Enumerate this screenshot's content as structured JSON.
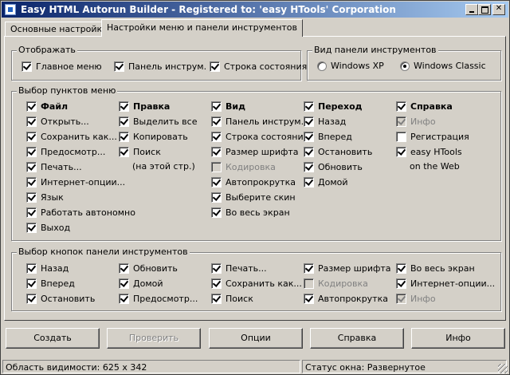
{
  "window": {
    "title": "Easy HTML Autorun Builder - Registered to: 'easy HTools' Corporation"
  },
  "tabs": [
    "Основные настройки",
    "Настройки меню и панели инструментов"
  ],
  "display_group": {
    "title": "Отображать",
    "items": [
      {
        "label": "Главное меню",
        "checked": true
      },
      {
        "label": "Панель инструм.",
        "checked": true
      },
      {
        "label": "Строка состояния",
        "checked": true
      }
    ]
  },
  "toolbar_view_group": {
    "title": "Вид панели инструментов",
    "options": [
      {
        "label": "Windows XP",
        "selected": false
      },
      {
        "label": "Windows Classic",
        "selected": true
      }
    ]
  },
  "menu_group": {
    "title": "Выбор пунктов меню",
    "columns": [
      {
        "items": [
          {
            "label": "Файл",
            "checked": true,
            "bold": true
          },
          {
            "label": "Открыть...",
            "checked": true
          },
          {
            "label": "Сохранить как...",
            "checked": true
          },
          {
            "label": "Предосмотр...",
            "checked": true
          },
          {
            "label": "Печать...",
            "checked": true
          },
          {
            "label": "Интернет-опции...",
            "checked": true
          },
          {
            "label": "Язык",
            "checked": true
          },
          {
            "label": "Работать автономно",
            "checked": true
          },
          {
            "label": "Выход",
            "checked": true
          }
        ]
      },
      {
        "items": [
          {
            "label": "Правка",
            "checked": true,
            "bold": true
          },
          {
            "label": "Выделить все",
            "checked": true
          },
          {
            "label": "Копировать",
            "checked": true
          },
          {
            "label": "Поиск",
            "checked": true
          }
        ],
        "note": "(на этой стр.)"
      },
      {
        "items": [
          {
            "label": "Вид",
            "checked": true,
            "bold": true
          },
          {
            "label": "Панель инструм.",
            "checked": true
          },
          {
            "label": "Строка состояния",
            "checked": true
          },
          {
            "label": "Размер шрифта",
            "checked": true
          },
          {
            "label": "Кодировка",
            "checked": false,
            "disabled": true
          },
          {
            "label": "Автопрокрутка",
            "checked": true
          },
          {
            "label": "Выберите скин",
            "checked": true
          },
          {
            "label": "Во весь экран",
            "checked": true
          }
        ]
      },
      {
        "items": [
          {
            "label": "Переход",
            "checked": true,
            "bold": true
          },
          {
            "label": "Назад",
            "checked": true
          },
          {
            "label": "Вперед",
            "checked": true
          },
          {
            "label": "Остановить",
            "checked": true
          },
          {
            "label": "Обновить",
            "checked": true
          },
          {
            "label": "Домой",
            "checked": true
          }
        ]
      },
      {
        "items": [
          {
            "label": "Справка",
            "checked": true,
            "bold": true
          },
          {
            "label": "Инфо",
            "checked": true,
            "disabled": true
          },
          {
            "label": "Регистрация",
            "checked": false
          },
          {
            "label": "easy HTools",
            "checked": true
          }
        ],
        "note": "on the Web"
      }
    ]
  },
  "toolbar_buttons_group": {
    "title": "Выбор кнопок панели инструментов",
    "columns": [
      [
        {
          "label": "Назад",
          "checked": true
        },
        {
          "label": "Вперед",
          "checked": true
        },
        {
          "label": "Остановить",
          "checked": true
        }
      ],
      [
        {
          "label": "Обновить",
          "checked": true
        },
        {
          "label": "Домой",
          "checked": true
        },
        {
          "label": "Предосмотр...",
          "checked": true
        }
      ],
      [
        {
          "label": "Печать...",
          "checked": true
        },
        {
          "label": "Сохранить как...",
          "checked": true
        },
        {
          "label": "Поиск",
          "checked": true
        }
      ],
      [
        {
          "label": "Размер шрифта",
          "checked": true
        },
        {
          "label": "Кодировка",
          "checked": false,
          "disabled": true
        },
        {
          "label": "Автопрокрутка",
          "checked": true
        }
      ],
      [
        {
          "label": "Во весь экран",
          "checked": true
        },
        {
          "label": "Интернет-опции...",
          "checked": true
        },
        {
          "label": "Инфо",
          "checked": true,
          "disabled": true
        }
      ]
    ]
  },
  "buttons": [
    {
      "label": "Создать",
      "disabled": false
    },
    {
      "label": "Проверить",
      "disabled": true
    },
    {
      "label": "Опции",
      "disabled": false
    },
    {
      "label": "Справка",
      "disabled": false
    },
    {
      "label": "Инфо",
      "disabled": false
    }
  ],
  "status": {
    "viewport": "Область видимости: 625 x 342",
    "window_state": "Статус окна: Развернутое"
  }
}
